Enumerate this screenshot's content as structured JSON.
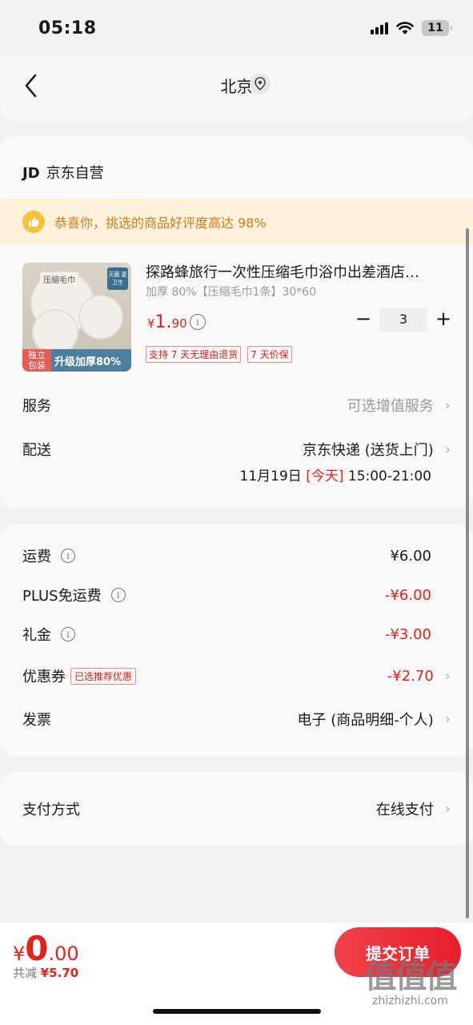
{
  "status_bar": {
    "time": "05:18",
    "battery": "11"
  },
  "nav": {
    "title": "北京",
    "back_icon": "chevron-left-icon",
    "location_icon": "location-pin-icon"
  },
  "shop": {
    "logo": "JD",
    "name": "京东自营",
    "congrats": "恭喜你，挑选的商品好评度高达 98%"
  },
  "product": {
    "title": "探路蜂旅行一次性压缩毛巾浴巾出差酒店…",
    "spec": "加厚 80%【压缩毛巾1条】30*60",
    "price_currency": "¥",
    "price_int": "1.",
    "price_dec": "90",
    "quantity": "3",
    "minus": "−",
    "plus": "+",
    "tags": [
      "支持 7 天无理由退货",
      "7 天价保"
    ],
    "image_text": {
      "label": "压缩毛巾",
      "corner": "灭菌 更卫生",
      "independent": "独立 包装",
      "upgrade": "升级加厚80%"
    }
  },
  "service": {
    "label": "服务",
    "value": "可选增值服务"
  },
  "delivery": {
    "label": "配送",
    "method": "京东快递 (送货上门)",
    "date": "11月19日",
    "today": "[今天]",
    "time": "15:00-21:00"
  },
  "fees": {
    "shipping": {
      "label": "运费",
      "value": "¥6.00"
    },
    "plus_free": {
      "label": "PLUS免运费",
      "value": "-¥6.00"
    },
    "gift": {
      "label": "礼金",
      "value": "-¥3.00"
    },
    "coupon": {
      "label": "优惠券",
      "tag": "已选推荐优惠",
      "value": "-¥2.70"
    },
    "invoice": {
      "label": "发票",
      "value": "电子 (商品明细-个人)"
    }
  },
  "payment": {
    "label": "支付方式",
    "value": "在线支付"
  },
  "bottom": {
    "currency": "¥",
    "total_int": "0",
    "total_dec": ".00",
    "saved_label": "共减",
    "saved_value": "¥5.70",
    "submit": "提交订单"
  },
  "watermark": {
    "big": "值值值",
    "small": "zhizhizhi.com"
  },
  "colors": {
    "accent_red": "#e2231a",
    "congrats_bg": "#fdf3dc",
    "congrats_text": "#d27a1c"
  }
}
